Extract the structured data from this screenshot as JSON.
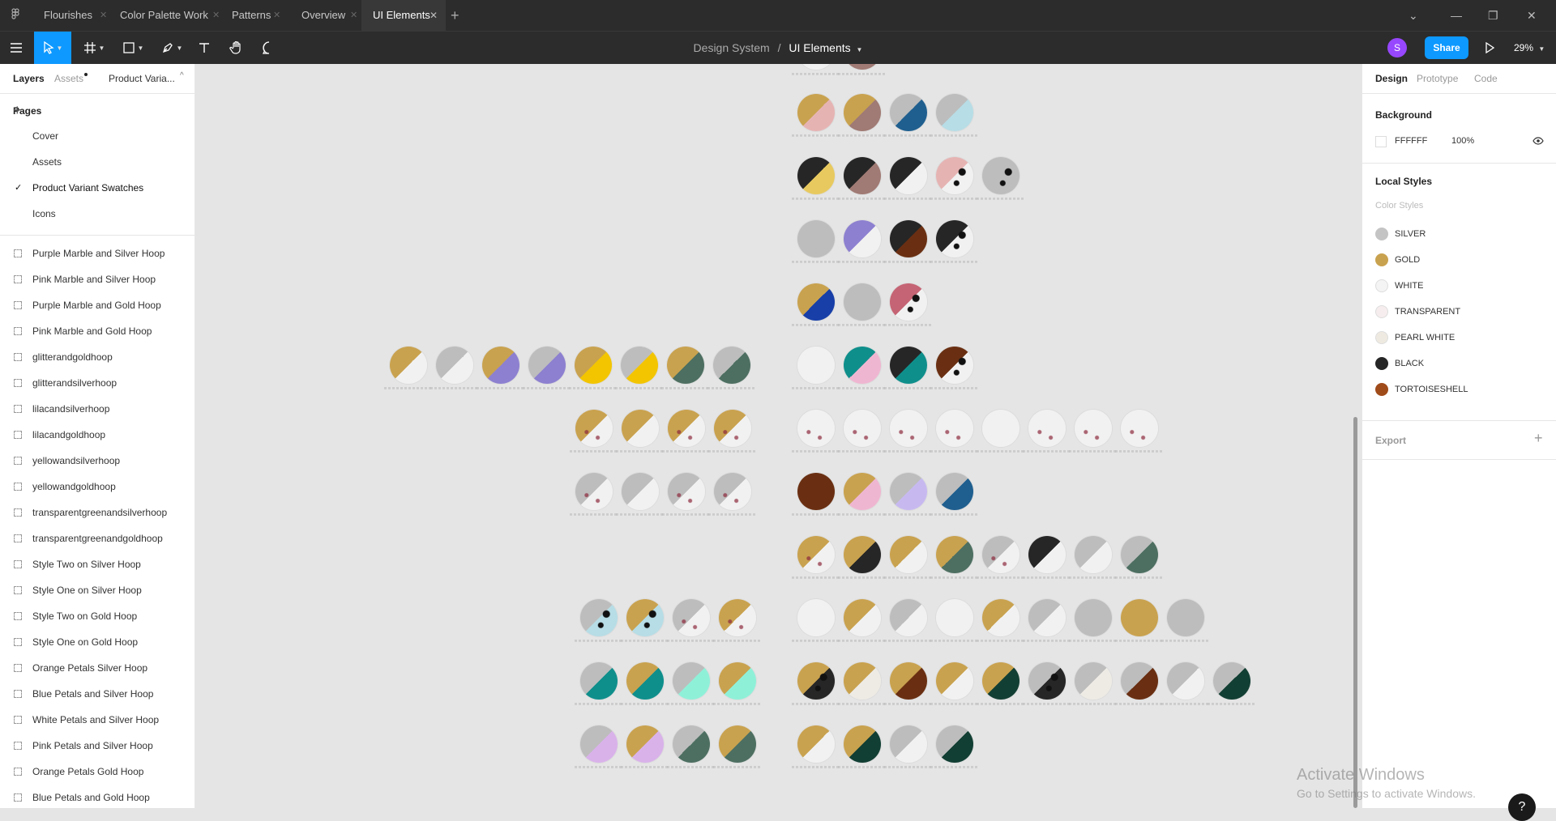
{
  "tabs": [
    {
      "label": "Flourishes",
      "active": false
    },
    {
      "label": "Color Palette Work",
      "active": false
    },
    {
      "label": "Patterns",
      "active": false
    },
    {
      "label": "Overview",
      "active": false
    },
    {
      "label": "UI Elements",
      "active": true
    }
  ],
  "toolbar": {
    "breadcrumb_project": "Design System",
    "breadcrumb_sep": "/",
    "breadcrumb_file": "UI Elements",
    "avatar_initial": "S",
    "share_label": "Share",
    "zoom": "29%"
  },
  "left_panel": {
    "tabs": [
      "Layers",
      "Assets",
      "Product Varia..."
    ],
    "pages_title": "Pages",
    "pages": [
      {
        "label": "Cover",
        "selected": false
      },
      {
        "label": "Assets",
        "selected": false
      },
      {
        "label": "Product Variant Swatches",
        "selected": true
      },
      {
        "label": "Icons",
        "selected": false
      }
    ],
    "layers": [
      "Purple Marble and Silver Hoop",
      "Pink Marble and Silver Hoop",
      "Purple Marble and Gold Hoop",
      "Pink Marble and Gold Hoop",
      "glitterandgoldhoop",
      "glitterandsilverhoop",
      "lilacandsilverhoop",
      "lilacandgoldhoop",
      "yellowandsilverhoop",
      "yellowandgoldhoop",
      "transparentgreenandsilverhoop",
      "transparentgreenandgoldhoop",
      "Style Two on Silver Hoop",
      "Style One on Silver Hoop",
      "Style Two on Gold Hoop",
      "Style One on Gold Hoop",
      "Orange Petals Silver Hoop",
      "Blue Petals and Silver Hoop",
      "White Petals and Silver Hoop",
      "Pink Petals and Silver Hoop",
      "Orange Petals Gold Hoop",
      "Blue Petals and Gold Hoop"
    ]
  },
  "right_panel": {
    "tabs": [
      "Design",
      "Prototype",
      "Code"
    ],
    "background_title": "Background",
    "background_hex": "FFFFFF",
    "background_opacity": "100%",
    "local_styles_title": "Local Styles",
    "color_styles_title": "Color Styles",
    "styles": [
      {
        "name": "SILVER",
        "color": "#c4c4c4"
      },
      {
        "name": "GOLD",
        "color": "#c9a24f"
      },
      {
        "name": "WHITE",
        "color": "#f4f4f4"
      },
      {
        "name": "TRANSPARENT",
        "color": "#f6eeee"
      },
      {
        "name": "PEARL WHITE",
        "color": "#efeae1"
      },
      {
        "name": "BLACK",
        "color": "#262626"
      },
      {
        "name": "TORTOISESHELL",
        "color": "#a04b1a"
      }
    ],
    "export_title": "Export"
  },
  "watermark": {
    "title": "Activate Windows",
    "subtitle": "Go to Settings to activate Windows."
  },
  "help_label": "?"
}
